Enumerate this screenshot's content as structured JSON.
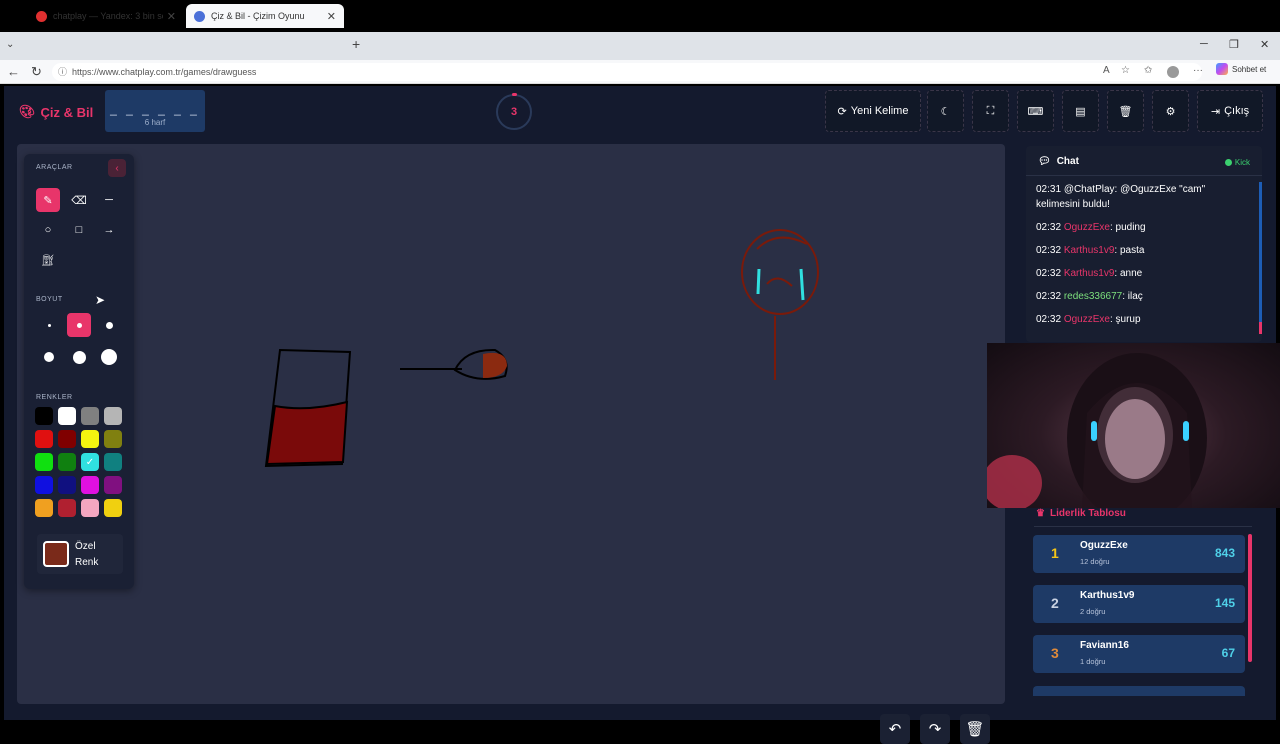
{
  "browser": {
    "tabs": [
      {
        "title": "chatplay — Yandex: 3 bin sonuç bu",
        "active": false
      },
      {
        "title": "Çiz & Bil - Çizim Oyunu",
        "active": true
      }
    ],
    "url": "https://www.chatplay.com.tr/games/drawguess",
    "chat_button": "Sohbet et"
  },
  "header": {
    "logo": "Çiz & Bil",
    "word_mask": "_ _ _ _ _ _",
    "word_hint": "6 harf",
    "timer": "3",
    "new_word": "Yeni Kelime",
    "exit": "Çıkış"
  },
  "tools": {
    "title_tools": "ARAÇLAR",
    "title_size": "BOYUT",
    "title_colors": "RENKLER",
    "custom_color_label": "Özel Renk",
    "colors": [
      "#000000",
      "#ffffff",
      "#808080",
      "#b5b5b5",
      "#e01010",
      "#800000",
      "#f4f410",
      "#808010",
      "#10e010",
      "#108010",
      "#30e0e0",
      "#108080",
      "#1010e0",
      "#101080",
      "#e010e0",
      "#801080",
      "#f0a020",
      "#b02030",
      "#f4a6c0",
      "#f0d010"
    ]
  },
  "chat": {
    "title": "Chat",
    "platform": "Kick",
    "messages": [
      {
        "time": "02:31",
        "user": "@ChatPlay:",
        "text": " @OguzzExe \"cam\" kelimesini buldu!",
        "color": "#ffffff"
      },
      {
        "time": "02:32",
        "user": "OguzzExe",
        "text": ": puding",
        "color": "#e8356a"
      },
      {
        "time": "02:32",
        "user": "Karthus1v9",
        "text": ": pasta",
        "color": "#e8356a"
      },
      {
        "time": "02:32",
        "user": "Karthus1v9",
        "text": ": anne",
        "color": "#e8356a"
      },
      {
        "time": "02:32",
        "user": "redes336677",
        "text": ": ilaç",
        "color": "#7de07d"
      },
      {
        "time": "02:32",
        "user": "OguzzExe",
        "text": ": şurup",
        "color": "#e8356a"
      }
    ]
  },
  "leaderboard": {
    "title": "Liderlik Tablosu",
    "rows": [
      {
        "rank": "1",
        "name": "OguzzExe",
        "sub": "12 doğru",
        "points": "843",
        "rank_color": "#f5c518"
      },
      {
        "rank": "2",
        "name": "Karthus1v9",
        "sub": "2 doğru",
        "points": "145",
        "rank_color": "#c9d2e3"
      },
      {
        "rank": "3",
        "name": "Faviann16",
        "sub": "1 doğru",
        "points": "67",
        "rank_color": "#e08a3a"
      }
    ]
  }
}
